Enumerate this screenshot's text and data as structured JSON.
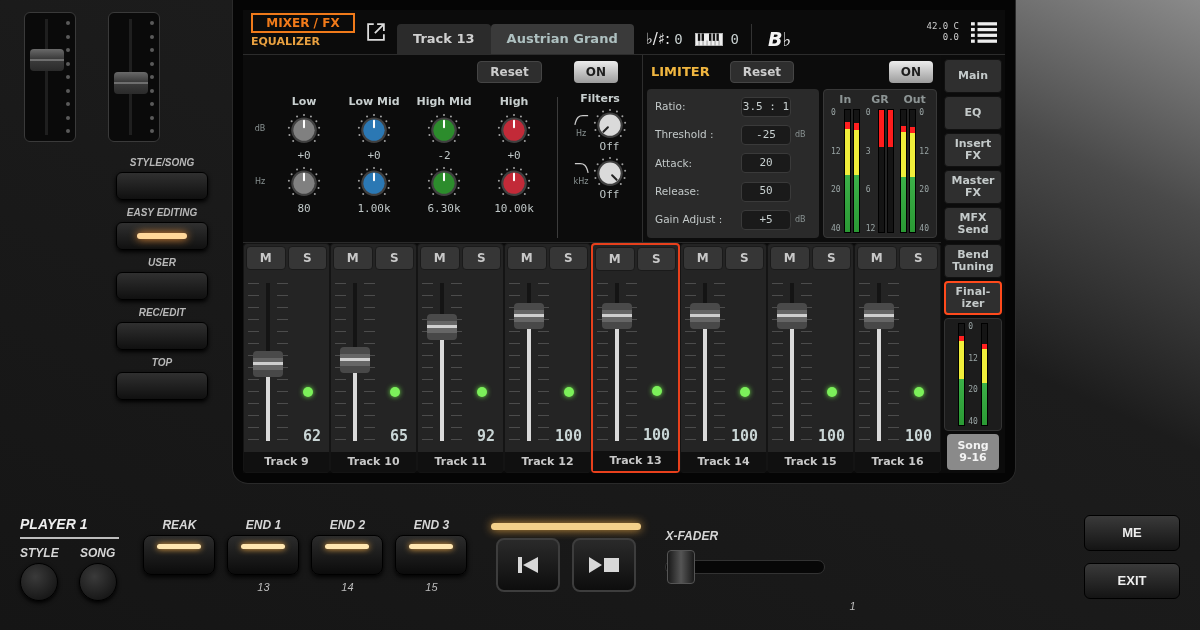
{
  "hardware_left": {
    "faders": [
      {
        "level": 0.62
      },
      {
        "level": 0.45
      }
    ],
    "buttons": [
      {
        "label": "STYLE/SONG",
        "lit": false
      },
      {
        "label": "EASY EDITING",
        "lit": true
      },
      {
        "label": "USER",
        "lit": false
      },
      {
        "label": "REC/EDIT",
        "lit": false
      },
      {
        "label": "TOP",
        "lit": false
      }
    ]
  },
  "screen": {
    "header": {
      "page": "MIXER / FX",
      "subpage": "EQUALIZER",
      "track": "Track 13",
      "sound": "Austrian Grand",
      "transpose": {
        "label": "♭/♯:",
        "value": "0"
      },
      "octave": {
        "value": "0"
      },
      "chord": "B♭",
      "status": [
        "42.0 C",
        "0.0"
      ]
    },
    "equalizer": {
      "reset": "Reset",
      "on": "ON",
      "gain_unit": "dB",
      "freq_unit": "Hz",
      "bands": [
        {
          "name": "Low",
          "color": "#808080",
          "gain": "+0",
          "freq": "80"
        },
        {
          "name": "Low Mid",
          "color": "#2b78b4",
          "gain": "+0",
          "freq": "1.00k"
        },
        {
          "name": "High Mid",
          "color": "#2c8c2c",
          "gain": "-2",
          "freq": "6.30k"
        },
        {
          "name": "High",
          "color": "#c22a38",
          "gain": "+0",
          "freq": "10.00k"
        }
      ]
    },
    "filters": {
      "title": "Filters",
      "items": [
        {
          "kind": "high_pass",
          "unit": "Hz",
          "value": "Off"
        },
        {
          "kind": "low_pass",
          "unit": "kHz",
          "value": "Off"
        }
      ]
    },
    "limiter": {
      "title": "LIMITER",
      "reset": "Reset",
      "on": "ON",
      "params": [
        {
          "label": "Ratio:",
          "value": "3.5 : 1"
        },
        {
          "label": "Threshold :",
          "value": "-25",
          "unit": "dB"
        },
        {
          "label": "Attack:",
          "value": "20"
        },
        {
          "label": "Release:",
          "value": "50"
        },
        {
          "label": "Gain Adjust :",
          "value": "+5",
          "unit": "dB"
        }
      ],
      "meters": [
        {
          "label": "In",
          "kind": "level",
          "scale": [
            "0",
            "12",
            "20",
            "40"
          ],
          "bars": [
            {
              "level": 0.9
            },
            {
              "level": 0.89
            }
          ]
        },
        {
          "label": "GR",
          "kind": "reduction",
          "scale": [
            "0",
            "3",
            "6",
            "12"
          ],
          "bars": [
            {
              "level": 0.3
            },
            {
              "level": 0.3
            }
          ]
        },
        {
          "label": "Out",
          "kind": "level",
          "scale": [
            "0",
            "12",
            "20",
            "40"
          ],
          "bars": [
            {
              "level": 0.87
            },
            {
              "level": 0.86
            }
          ]
        }
      ]
    },
    "channels": [
      {
        "name": "Track 9",
        "value": "62",
        "level": 0.49,
        "selected": false,
        "mute": {
          "label": "M",
          "on": false
        },
        "solo": {
          "label": "S",
          "on": false
        }
      },
      {
        "name": "Track 10",
        "value": "65",
        "level": 0.51,
        "selected": false,
        "mute": {
          "label": "M",
          "on": false
        },
        "solo": {
          "label": "S",
          "on": false
        }
      },
      {
        "name": "Track 11",
        "value": "92",
        "level": 0.72,
        "selected": false,
        "mute": {
          "label": "M",
          "on": false
        },
        "solo": {
          "label": "S",
          "on": false
        }
      },
      {
        "name": "Track 12",
        "value": "100",
        "level": 0.79,
        "selected": false,
        "mute": {
          "label": "M",
          "on": false
        },
        "solo": {
          "label": "S",
          "on": false
        }
      },
      {
        "name": "Track 13",
        "value": "100",
        "level": 0.79,
        "selected": true,
        "mute": {
          "label": "M",
          "on": false
        },
        "solo": {
          "label": "S",
          "on": false
        }
      },
      {
        "name": "Track 14",
        "value": "100",
        "level": 0.79,
        "selected": false,
        "mute": {
          "label": "M",
          "on": false
        },
        "solo": {
          "label": "S",
          "on": false
        }
      },
      {
        "name": "Track 15",
        "value": "100",
        "level": 0.79,
        "selected": false,
        "mute": {
          "label": "M",
          "on": false
        },
        "solo": {
          "label": "S",
          "on": false
        }
      },
      {
        "name": "Track 16",
        "value": "100",
        "level": 0.79,
        "selected": false,
        "mute": {
          "label": "M",
          "on": false
        },
        "solo": {
          "label": "S",
          "on": false
        }
      }
    ],
    "side_tabs": [
      {
        "label": "Main",
        "selected": false
      },
      {
        "label": "EQ",
        "selected": false
      },
      {
        "label": "Insert FX",
        "selected": false
      },
      {
        "label": "Master FX",
        "selected": false
      },
      {
        "label": "MFX Send",
        "selected": false
      },
      {
        "label": "Bend Tuning",
        "selected": false
      },
      {
        "label": "Final-izer",
        "selected": true
      }
    ],
    "master": {
      "scale": [
        "0",
        "12",
        "20",
        "40"
      ],
      "bars": [
        {
          "level": 0.88
        },
        {
          "level": 0.8
        }
      ],
      "button": "Song 9-16"
    }
  },
  "player_panel": {
    "title": "PLAYER 1",
    "select": [
      "STYLE",
      "SONG"
    ],
    "pads": [
      {
        "label": "REAK",
        "lit": true
      },
      {
        "label": "END 1",
        "number": "13",
        "lit": true
      },
      {
        "label": "END 2",
        "number": "14",
        "lit": true
      },
      {
        "label": "END 3",
        "number": "15",
        "lit": true
      }
    ],
    "transport": [
      {
        "kind": "home"
      },
      {
        "kind": "play_stop"
      }
    ],
    "xfader": {
      "label": "X-FADER",
      "level": 0.1
    },
    "marker": "1"
  },
  "right_panel": {
    "buttons": [
      "ME",
      "EXIT"
    ]
  }
}
